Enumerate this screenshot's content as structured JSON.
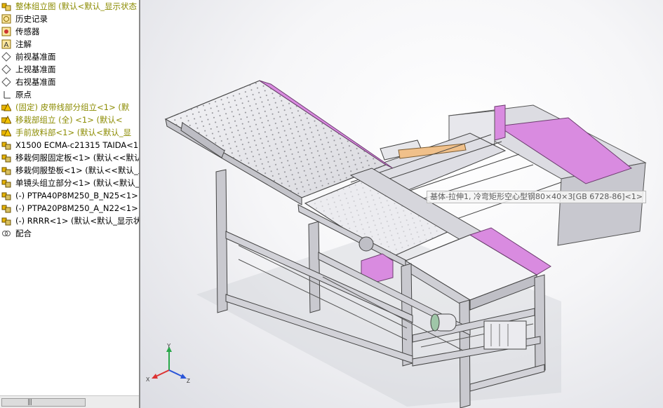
{
  "tree": {
    "items": [
      {
        "label": "整体组立图  (默认<默认_显示状态",
        "icon": "assembly-icon",
        "style": "olive"
      },
      {
        "label": "历史记录",
        "icon": "history-icon"
      },
      {
        "label": "传感器",
        "icon": "sensor-icon"
      },
      {
        "label": "注解",
        "icon": "annotation-icon"
      },
      {
        "label": "前视基准面",
        "icon": "plane-icon"
      },
      {
        "label": "上视基准面",
        "icon": "plane-icon"
      },
      {
        "label": "右视基准面",
        "icon": "plane-icon"
      },
      {
        "label": "原点",
        "icon": "origin-icon"
      },
      {
        "label": "(固定) 皮带线部分组立<1> (默",
        "icon": "subassembly-warning-icon",
        "style": "olive"
      },
      {
        "label": "移栽部组立 (全) <1> (默认<",
        "icon": "subassembly-warning-icon",
        "style": "olive"
      },
      {
        "label": "手前放料部<1> (默认<默认_显",
        "icon": "subassembly-warning-icon",
        "style": "olive"
      },
      {
        "label": "X1500 ECMA-c21315 TAIDA<1>",
        "icon": "subassembly-icon"
      },
      {
        "label": "移栽伺服固定板<1> (默认<<默认",
        "icon": "subassembly-icon"
      },
      {
        "label": "移栽伺服垫板<1> (默认<<默认_显",
        "icon": "subassembly-icon"
      },
      {
        "label": "单镜头组立部分<1> (默认<默认_显",
        "icon": "subassembly-icon"
      },
      {
        "label": "(-) PTPA40P8M250_B_N25<1> (",
        "icon": "subassembly-icon"
      },
      {
        "label": "(-) PTPA20P8M250_A_N22<1> (",
        "icon": "subassembly-icon"
      },
      {
        "label": "(-) RRRR<1> (默认<默认_显示状",
        "icon": "subassembly-icon"
      },
      {
        "label": "配合",
        "icon": "mates-icon"
      }
    ]
  },
  "viewport": {
    "tooltip": "基体-拉伸1, 冷弯矩形空心型钢80×40×3[GB 6728-86]<1>"
  },
  "triad": {
    "x_label": "X",
    "y_label": "Y",
    "z_label": "Z"
  },
  "colors": {
    "accent_pink": "#d98be0",
    "frame_gray": "#cfcfd4",
    "warning": "#e8b400",
    "tree_olive": "#8b8b00"
  }
}
